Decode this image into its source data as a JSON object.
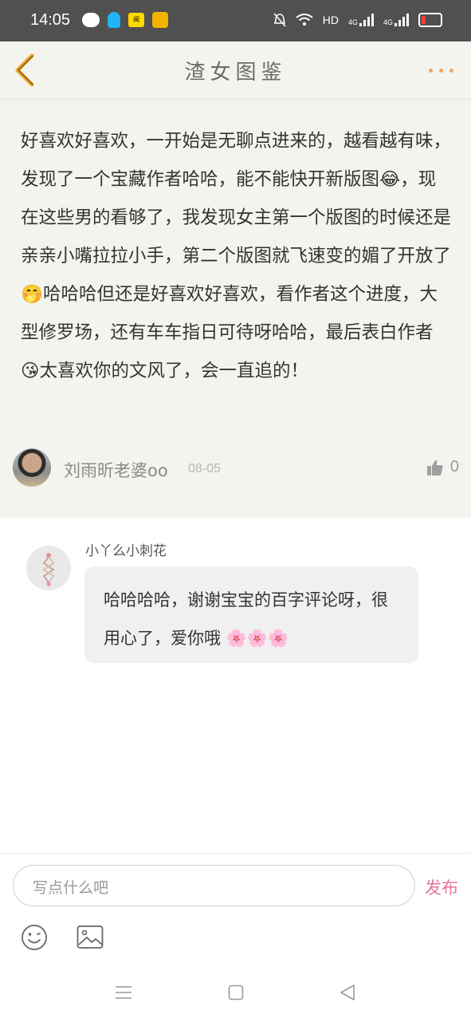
{
  "status_bar": {
    "time": "14:05",
    "network": "HD",
    "signal1": "4G",
    "signal2": "4G",
    "read_app_label": "阅"
  },
  "header": {
    "title": "渣女图鉴"
  },
  "comment": {
    "text": "好喜欢好喜欢，一开始是无聊点进来的，越看越有味，发现了一个宝藏作者哈哈，能不能快开新版图😂，现在这些男的看够了，我发现女主第一个版图的时候还是亲亲小嘴拉拉小手，第二个版图就飞速变的媚了开放了🤭哈哈哈但还是好喜欢好喜欢，看作者这个进度，大型修罗场，还有车车指日可待呀哈哈，最后表白作者😘太喜欢你的文风了，会一直追的！",
    "author": "刘雨昕老婆oo",
    "date": "08-05",
    "likes": "0"
  },
  "reply": {
    "author": "小丫么小刺花",
    "text": "哈哈哈哈，谢谢宝宝的百字评论呀，很用心了，爱你哦 🌸🌸🌸"
  },
  "input": {
    "placeholder": "写点什么吧",
    "publish_label": "发布"
  },
  "colors": {
    "accent_orange": "#f5a25a",
    "publish_pink": "#e9739a",
    "comment_bg": "#f4f4ef",
    "status_bar_bg": "#505050"
  },
  "icons": {
    "back": "chevron-left-icon",
    "more": "more-dots-icon",
    "like": "thumbs-up-icon",
    "emoji": "smiley-icon",
    "image": "image-icon"
  }
}
